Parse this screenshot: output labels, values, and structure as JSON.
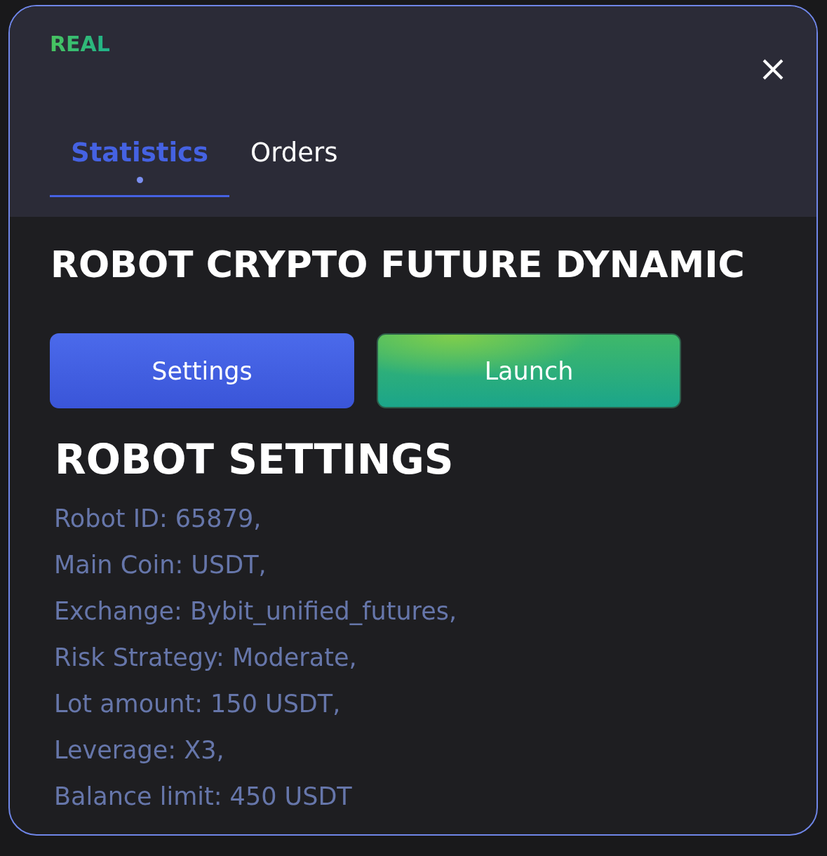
{
  "badge": {
    "label": "REAL"
  },
  "tabs": [
    {
      "label": "Statistics",
      "selected": true
    },
    {
      "label": "Orders",
      "selected": false
    }
  ],
  "robot": {
    "title": "ROBOT CRYPTO FUTURE DYNAMIC",
    "buttons": [
      {
        "label": "Settings",
        "kind": "primary"
      },
      {
        "label": "Launch",
        "kind": "success"
      }
    ]
  },
  "settings": {
    "title": "ROBOT SETTINGS",
    "lines": [
      "Robot ID: 65879,",
      "Main Coin: USDT,",
      "Exchange: Bybit_unified_futures,",
      "Risk Strategy: Moderate,",
      "Lot amount: 150 USDT,",
      "Leverage: X3,",
      "Balance limit: 450 USDT"
    ]
  }
}
